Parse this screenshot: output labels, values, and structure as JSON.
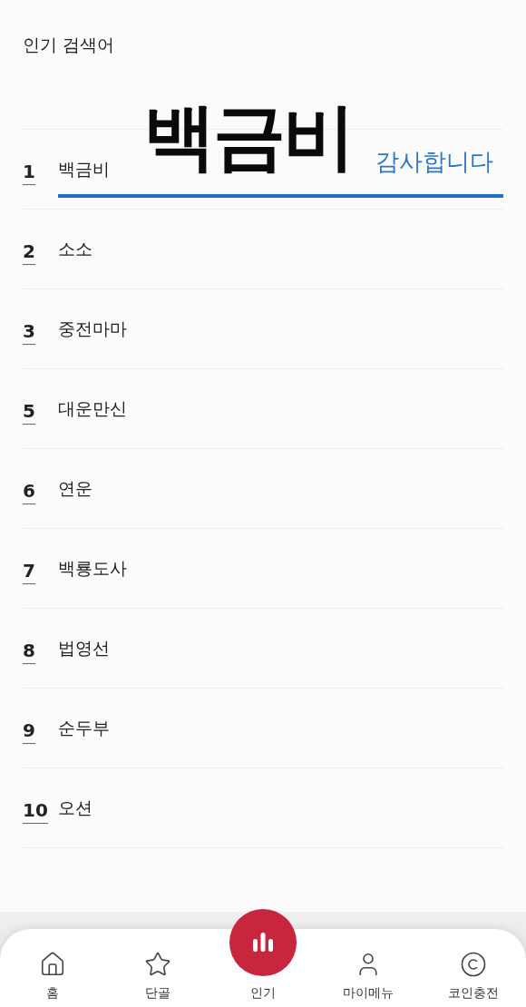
{
  "title": "인기 검색어",
  "overlay": {
    "headline": "백금비",
    "note": "감사합니다"
  },
  "ranking": [
    {
      "rank": "1",
      "name": "백금비"
    },
    {
      "rank": "2",
      "name": "소소"
    },
    {
      "rank": "3",
      "name": "중전마마"
    },
    {
      "rank": "5",
      "name": "대운만신"
    },
    {
      "rank": "6",
      "name": "연운"
    },
    {
      "rank": "7",
      "name": "백룡도사"
    },
    {
      "rank": "8",
      "name": "법영선"
    },
    {
      "rank": "9",
      "name": "순두부"
    },
    {
      "rank": "10",
      "name": "오션"
    }
  ],
  "bottom_nav": [
    {
      "kind": "home",
      "label": "홈",
      "selected": false
    },
    {
      "kind": "star",
      "label": "단골",
      "selected": false
    },
    {
      "kind": "chart",
      "label": "인기",
      "selected": true
    },
    {
      "kind": "person",
      "label": "마이메뉴",
      "selected": false
    },
    {
      "kind": "coin",
      "label": "코인충전",
      "selected": false
    }
  ]
}
